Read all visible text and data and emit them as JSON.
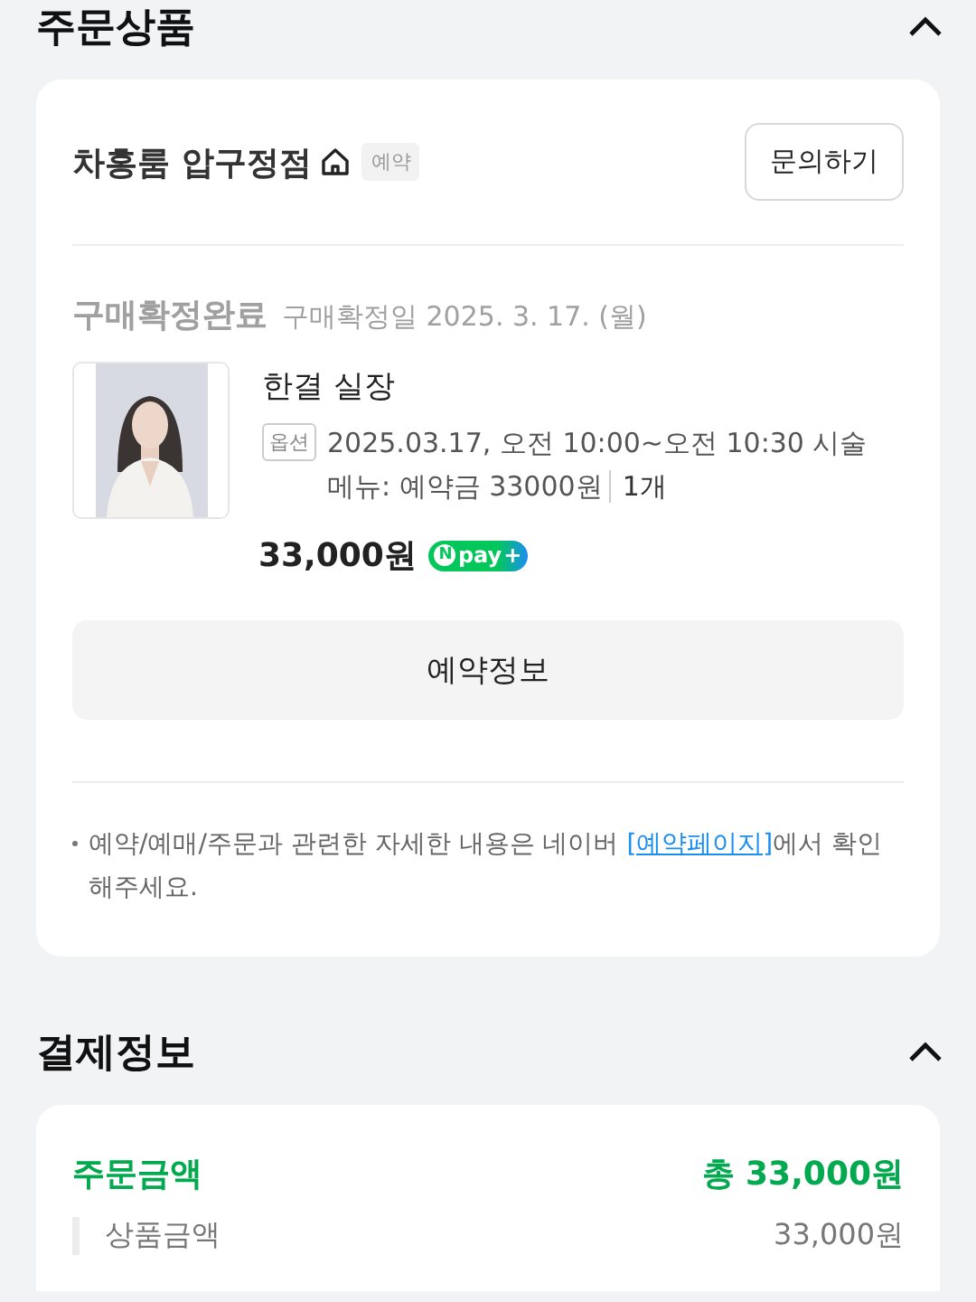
{
  "order_section": {
    "title": "주문상품",
    "expanded": true,
    "store": {
      "name": "차홍룸 압구정점",
      "badge": "예약",
      "inquiry_button": "문의하기"
    },
    "status": "구매확정완료",
    "confirm_date": "구매확정일 2025. 3. 17. (월)",
    "product": {
      "name": "한결 실장",
      "option_tag": "옵션",
      "option_text": "2025.03.17, 오전 10:00~오전 10:30 시술메뉴: 예약금 33000원",
      "quantity": "1개",
      "price": "33,000원",
      "pay_badge": {
        "mark": "N",
        "text": "pay",
        "plus": "+"
      }
    },
    "reservation_button": "예약정보",
    "note": {
      "before": "예약/예매/주문과 관련한 자세한 내용은 네이버 ",
      "link": "[예약페이지]",
      "after": "에서 확인해주세요."
    }
  },
  "payment_section": {
    "title": "결제정보",
    "expanded": true,
    "order_amount": {
      "label": "주문금액",
      "value": "총 33,000원"
    },
    "lines": [
      {
        "label": "상품금액",
        "value": "33,000원"
      }
    ]
  }
}
